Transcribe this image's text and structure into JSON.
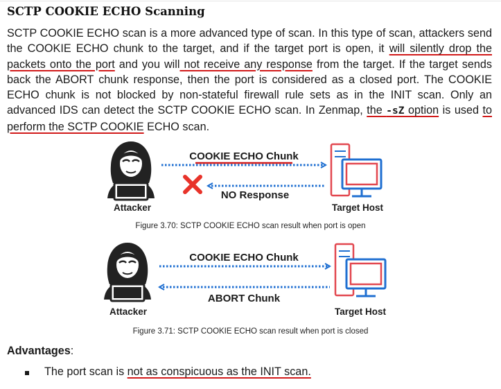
{
  "heading": "SCTP COOKIE ECHO Scanning",
  "paragraph": {
    "s1": "SCTP COOKIE ECHO scan is a more advanced type of scan. In this type of scan, attackers send the COOKIE ECHO chunk to the target, and if the target port is open, it ",
    "u1": "will silently drop the packets onto the port",
    "s2": " and you will",
    "u2": " not receive any response",
    "s3": " from the target. If the target sends back the ABORT chunk response, then the port is considered as a closed port. The COOKIE ECHO chunk is not blocked by non-stateful firewall rule sets as in the INIT scan. Only an advanced IDS can detect the SCTP COOKIE ECHO scan. In Zenmap, ",
    "u3a": "the ",
    "u3code": "-sZ",
    "u3b": " option",
    "s4": " is used ",
    "u4": "to perform the SCTP COOKIE",
    "s5": " ECHO scan."
  },
  "figure1": {
    "top_label": "COOKIE ECHO Chunk",
    "bottom_label": "NO Response",
    "attacker_label": "Attacker",
    "target_label": "Target Host",
    "caption": "Figure 3.70: SCTP COOKIE ECHO scan result when port is open"
  },
  "figure2": {
    "top_label": "COOKIE ECHO Chunk",
    "bottom_label": "ABORT Chunk",
    "attacker_label": "Attacker",
    "target_label": "Target Host",
    "caption": "Figure 3.71: SCTP COOKIE ECHO scan result when port is closed"
  },
  "advantages": {
    "title": "Advantages",
    "colon": ":",
    "items": [
      {
        "prefix": "The port scan is ",
        "underlined": "not as conspicuous as the INIT scan."
      }
    ]
  },
  "colors": {
    "arrow_blue": "#1f6fd1",
    "underline_red": "#d11a1a",
    "monitor_red": "#e2474f",
    "cross_red": "#e8332a",
    "hacker_dark": "#222222"
  },
  "icons": [
    "hacker-icon",
    "server-monitor-icon",
    "cross-icon",
    "arrow-right-icon",
    "arrow-left-icon"
  ]
}
